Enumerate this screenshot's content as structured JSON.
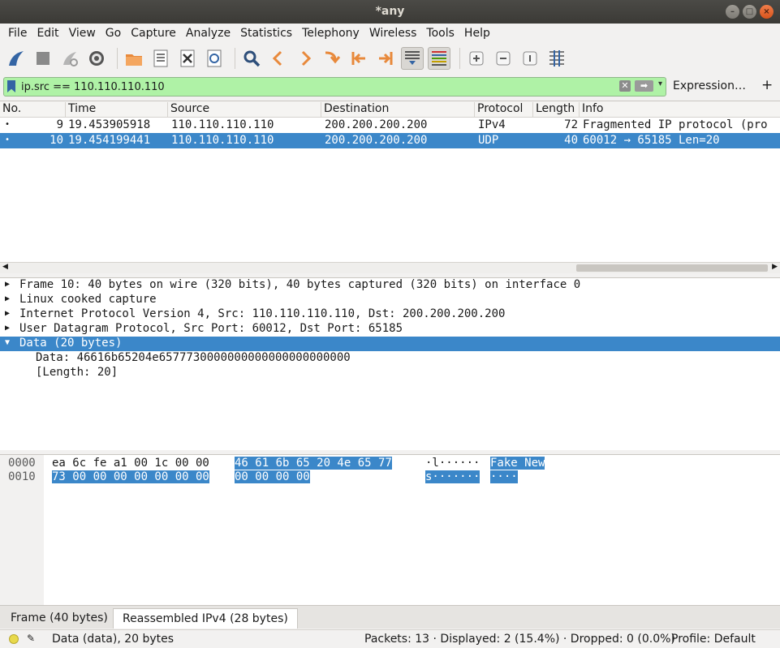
{
  "window": {
    "title": "*any"
  },
  "menu": [
    "File",
    "Edit",
    "View",
    "Go",
    "Capture",
    "Analyze",
    "Statistics",
    "Telephony",
    "Wireless",
    "Tools",
    "Help"
  ],
  "filter": {
    "value": "ip.src == 110.110.110.110",
    "expression_label": "Expression…",
    "add_label": "+"
  },
  "packet_list": {
    "columns": [
      "No.",
      "Time",
      "Source",
      "Destination",
      "Protocol",
      "Length",
      "Info"
    ],
    "rows": [
      {
        "no": "9",
        "time": "19.453905918",
        "source": "110.110.110.110",
        "destination": "200.200.200.200",
        "protocol": "IPv4",
        "length": "72",
        "info": "Fragmented IP protocol (pro",
        "marker": "•"
      },
      {
        "no": "10",
        "time": "19.454199441",
        "source": "110.110.110.110",
        "destination": "200.200.200.200",
        "protocol": "UDP",
        "length": "40",
        "info": "60012 → 65185 Len=20",
        "marker": "•"
      }
    ]
  },
  "details": [
    {
      "text": "Frame 10: 40 bytes on wire (320 bits), 40 bytes captured (320 bits) on interface 0"
    },
    {
      "text": "Linux cooked capture"
    },
    {
      "text": "Internet Protocol Version 4, Src: 110.110.110.110, Dst: 200.200.200.200"
    },
    {
      "text": "User Datagram Protocol, Src Port: 60012, Dst Port: 65185"
    },
    {
      "text": "Data (20 bytes)"
    },
    {
      "text": "Data: 46616b65204e6577730000000000000000000000"
    },
    {
      "text": "[Length: 20]"
    }
  ],
  "bytes": {
    "rows": [
      {
        "offset": "0000",
        "hex_a": "ea 6c fe a1 00 1c 00 00",
        "hex_b": "46 61 6b 65 20 4e 65 77",
        "ascii_a": "·l······",
        "ascii_b": "Fake New"
      },
      {
        "offset": "0010",
        "hex_a": "73 00 00 00 00 00 00 00",
        "hex_b": "00 00 00 00",
        "ascii_a": "s·······",
        "ascii_b": "····"
      }
    ]
  },
  "tabs": [
    "Frame (40 bytes)",
    "Reassembled IPv4 (28 bytes)"
  ],
  "status": {
    "left": "Data (data), 20 bytes",
    "packets": "Packets: 13 · Displayed: 2 (15.4%) · Dropped: 0 (0.0%)",
    "profile": "Profile: Default"
  }
}
